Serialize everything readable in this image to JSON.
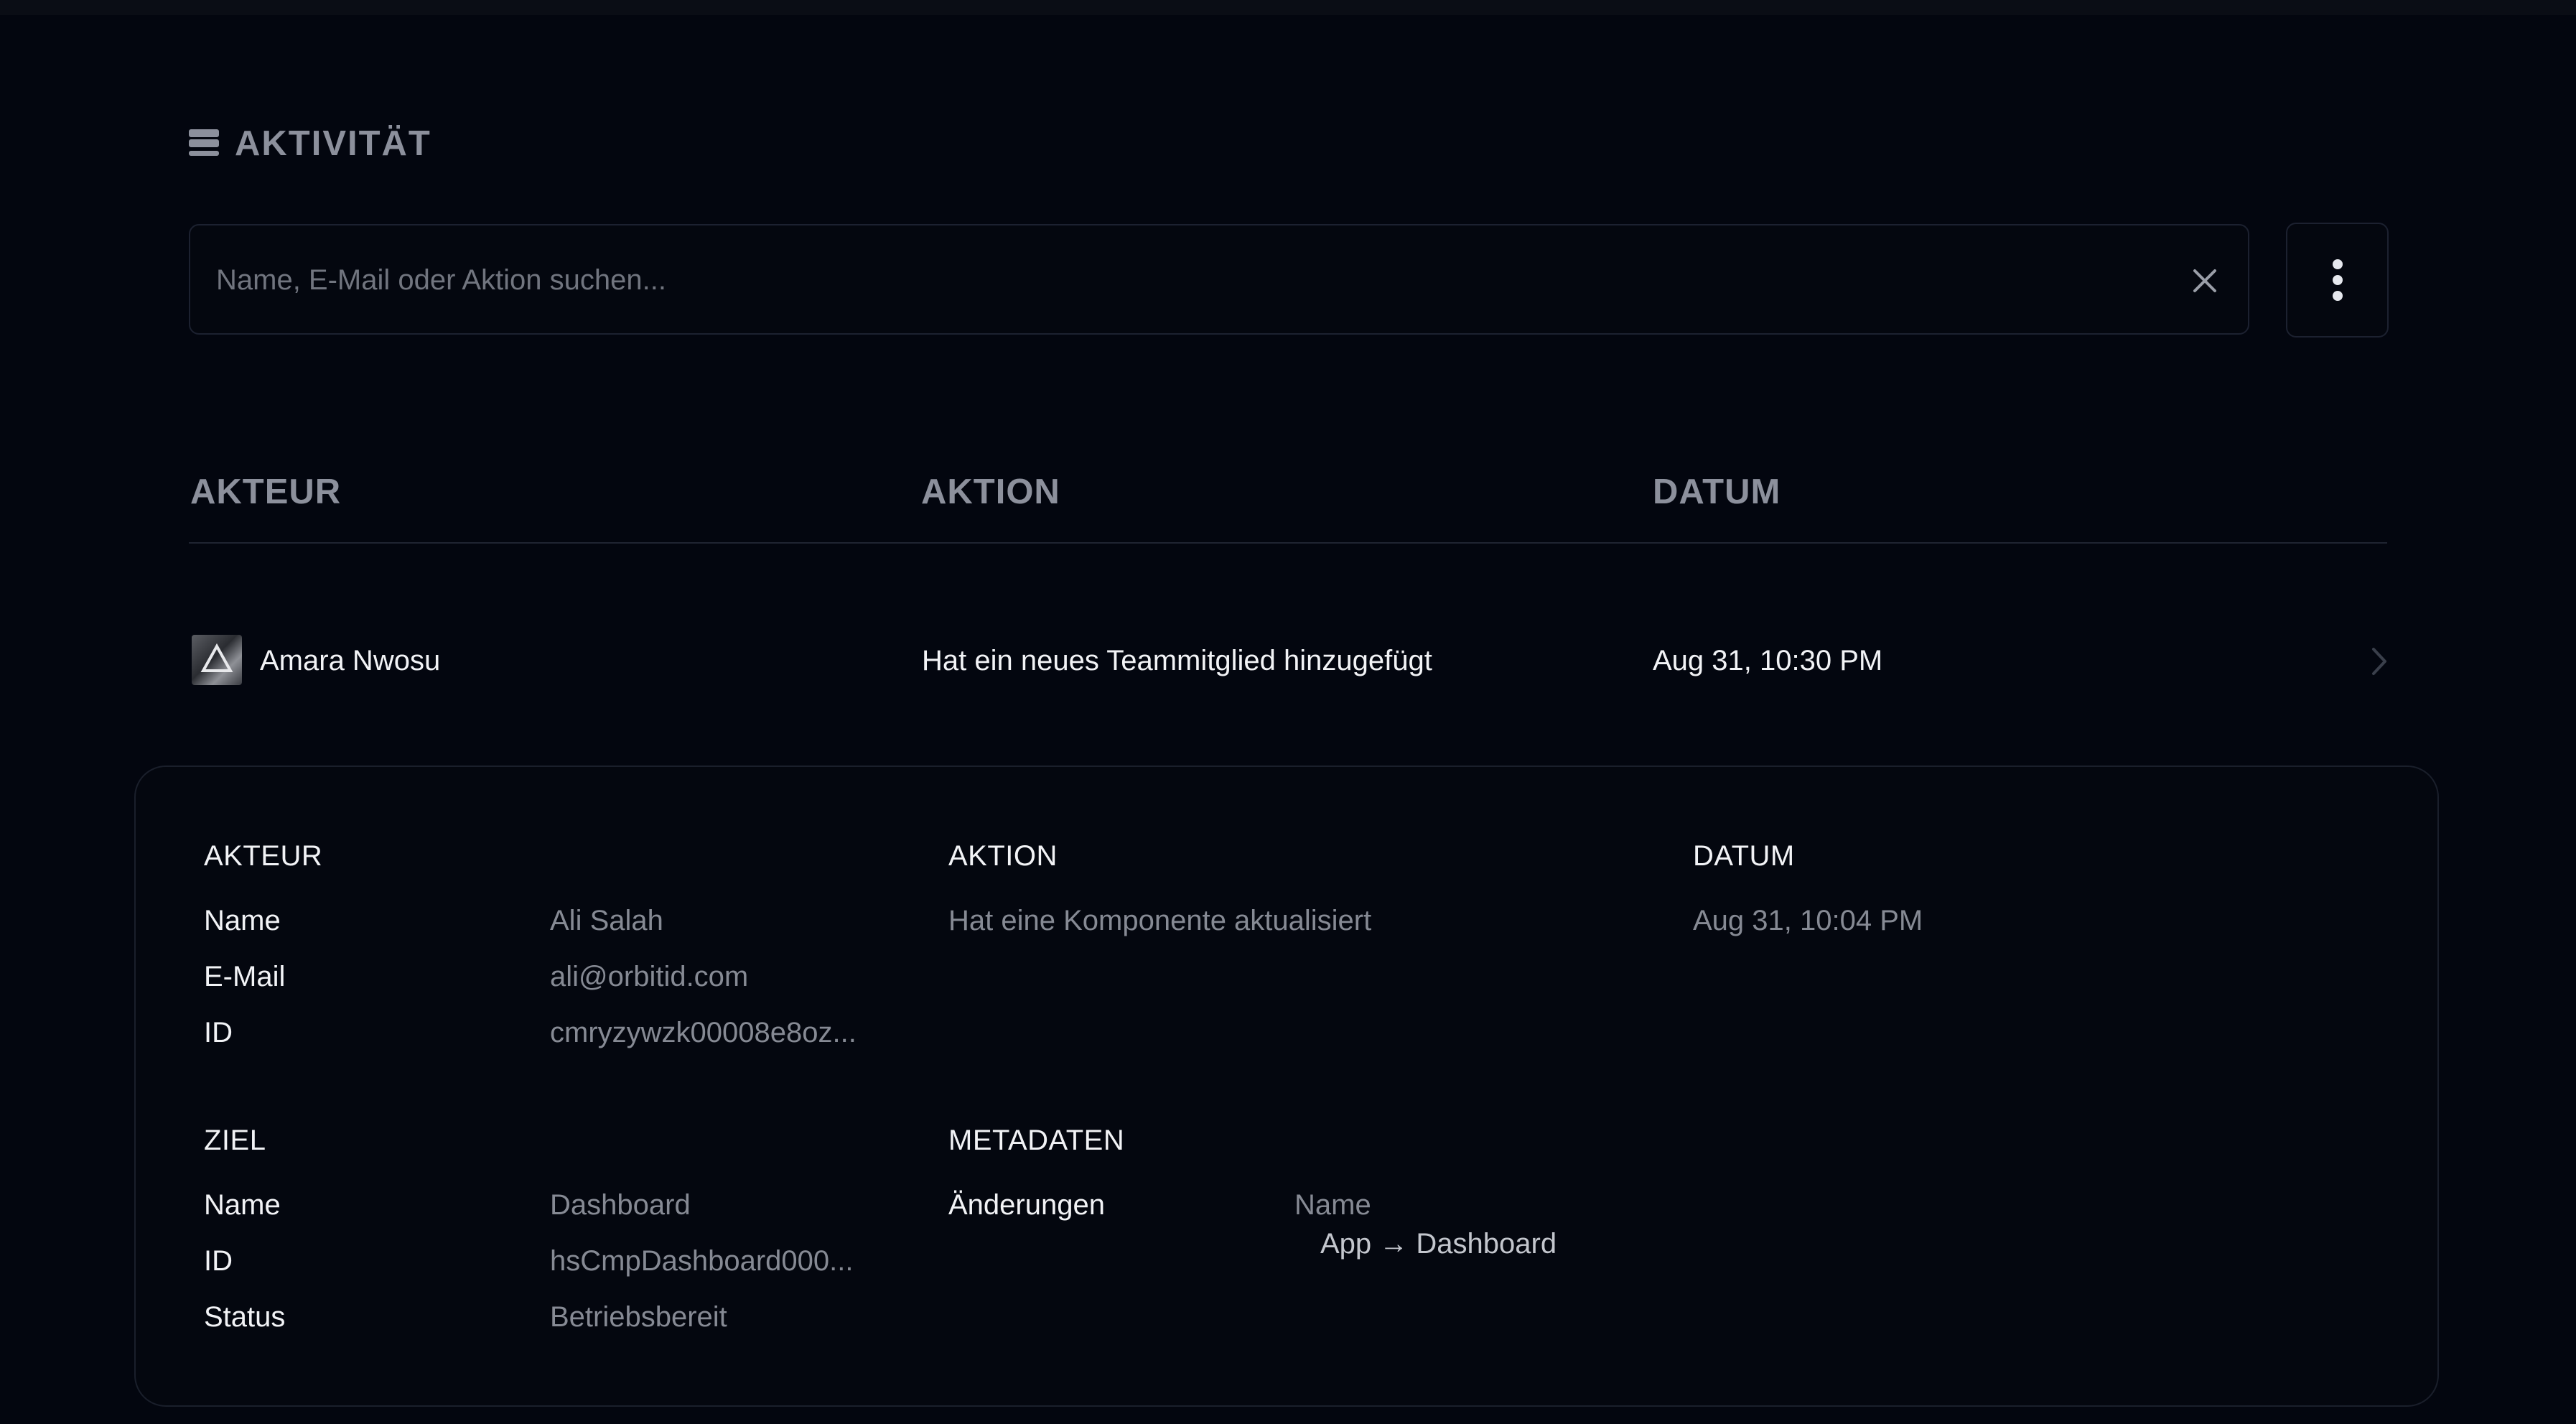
{
  "section": {
    "title": "AKTIVITÄT",
    "icon": "stack-icon"
  },
  "search": {
    "value": "",
    "placeholder": "Name, E-Mail oder Aktion suchen...",
    "clear_icon": "close-icon"
  },
  "menu": {
    "icon": "more-vertical-icon"
  },
  "table": {
    "headers": {
      "actor": "AKTEUR",
      "action": "AKTION",
      "date": "DATUM"
    },
    "rows": [
      {
        "actor": "Amara Nwosu",
        "action": "Hat ein neues Teammitglied hinzugefügt",
        "date": "Aug 31, 10:30 PM"
      }
    ]
  },
  "detail": {
    "actor": {
      "title": "AKTEUR",
      "name_label": "Name",
      "name": "Ali Salah",
      "email_label": "E-Mail",
      "email": "ali@orbitid.com",
      "id_label": "ID",
      "id": "cmryzywzk00008e8oz..."
    },
    "action": {
      "title": "AKTION",
      "value": "Hat eine Komponente aktualisiert"
    },
    "date": {
      "title": "DATUM",
      "value": "Aug 31, 10:04 PM"
    },
    "target": {
      "title": "ZIEL",
      "name_label": "Name",
      "name": "Dashboard",
      "id_label": "ID",
      "id": "hsCmpDashboard000...",
      "status_label": "Status",
      "status": "Betriebsbereit"
    },
    "metadata": {
      "title": "METADATEN",
      "changes_label": "Änderungen",
      "field": "Name",
      "change": "App → Dashboard"
    }
  },
  "colors": {
    "background": "#03060f",
    "border": "#1c2130",
    "muted": "#868a94",
    "heading": "#8c909c"
  }
}
